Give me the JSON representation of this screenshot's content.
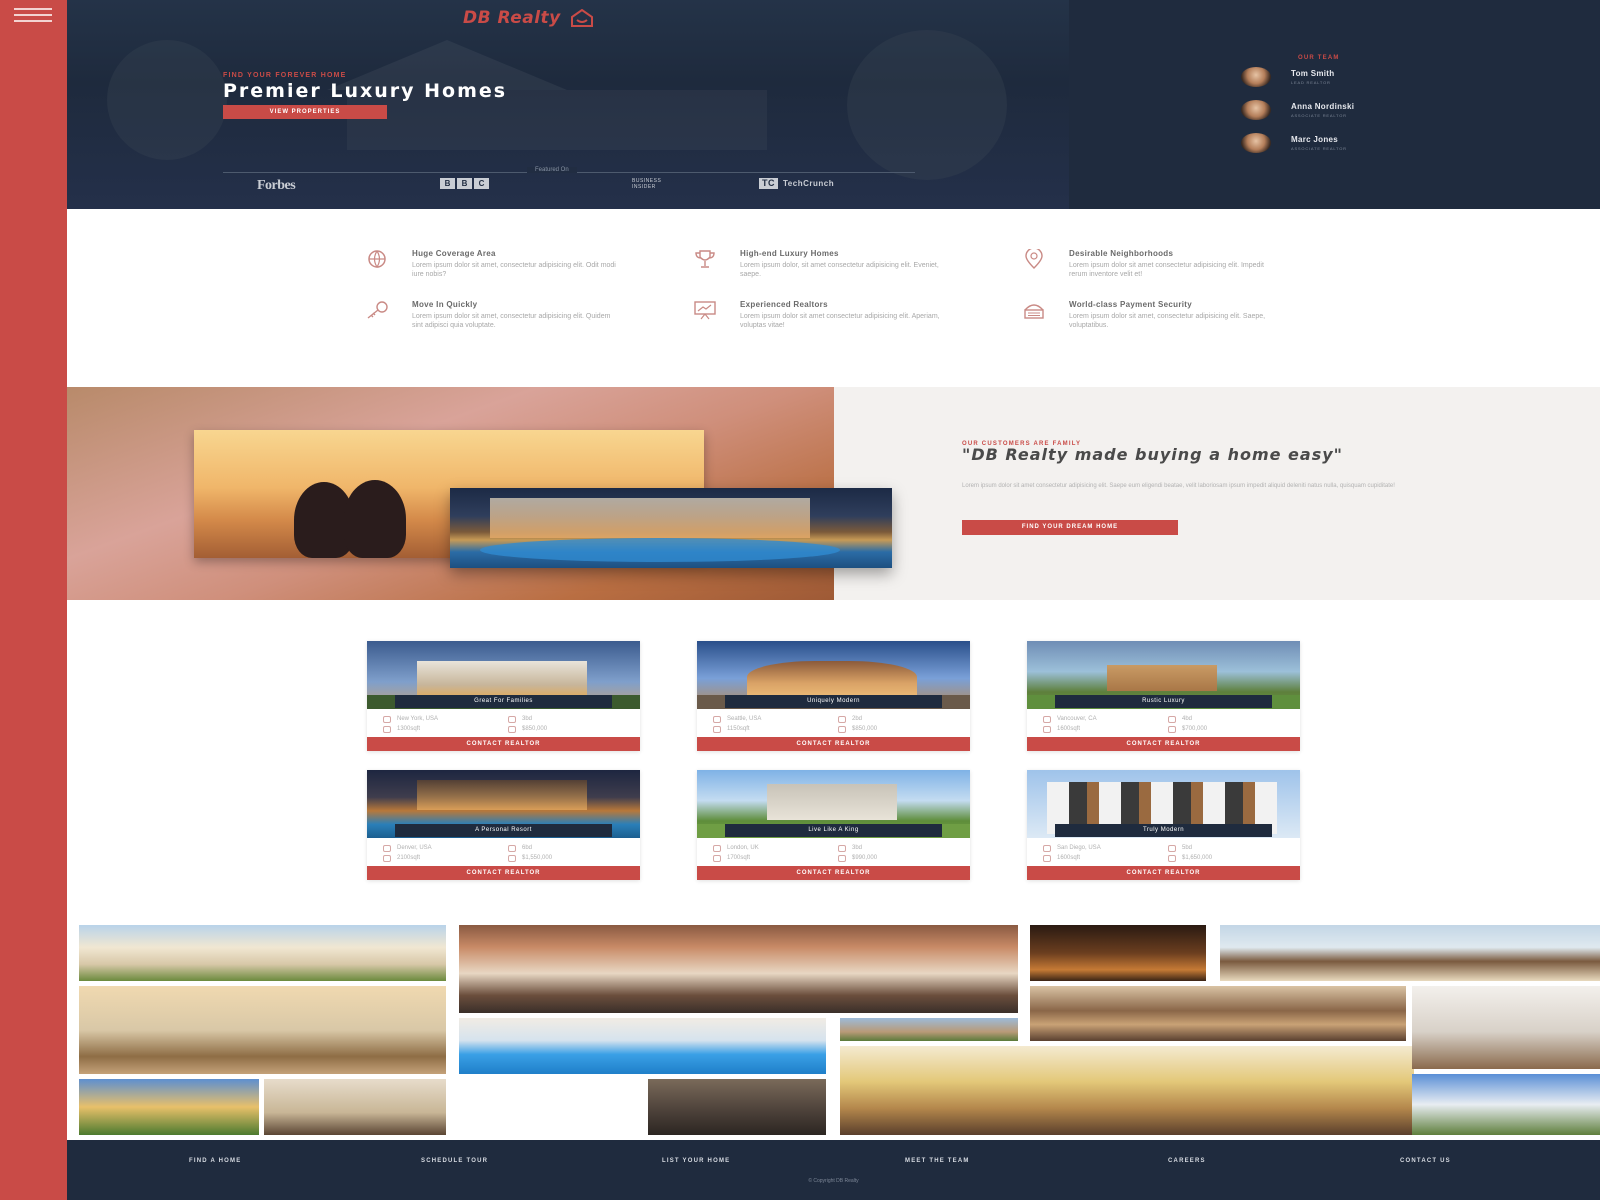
{
  "brand": {
    "name": "DB Realty",
    "accent": "#c94b47",
    "navy": "#1f2b3e"
  },
  "hero": {
    "eyebrow": "FIND YOUR FOREVER HOME",
    "title": "Premier Luxury Homes",
    "button": "VIEW PROPERTIES",
    "featured_label": "Featured On",
    "press": {
      "forbes": "Forbes",
      "bbc": [
        "B",
        "B",
        "C"
      ],
      "business_insider": [
        "BUSINESS",
        "INSIDER"
      ],
      "techcrunch_mark": "TC",
      "techcrunch": "TechCrunch"
    }
  },
  "team": {
    "label": "OUR TEAM",
    "members": [
      {
        "name": "Tom Smith",
        "role": "LEAD REALTOR"
      },
      {
        "name": "Anna Nordinski",
        "role": "ASSOCIATE REALTOR"
      },
      {
        "name": "Marc Jones",
        "role": "ASSOCIATE REALTOR"
      }
    ]
  },
  "features": [
    {
      "icon": "globe-icon",
      "title": "Huge Coverage Area",
      "desc": "Lorem ipsum dolor sit amet, consectetur adipisicing elit. Odit modi iure nobis?"
    },
    {
      "icon": "trophy-icon",
      "title": "High-end Luxury Homes",
      "desc": "Lorem ipsum dolor, sit amet consectetur adipisicing elit. Eveniet, saepe."
    },
    {
      "icon": "location-pin-icon",
      "title": "Desirable Neighborhoods",
      "desc": "Lorem ipsum dolor sit amet consectetur adipisicing elit. Impedit rerum inventore velit et!"
    },
    {
      "icon": "key-icon",
      "title": "Move In Quickly",
      "desc": "Lorem ipsum dolor sit amet, consectetur adipisicing elit. Quidem sint adipisci quia voluptate."
    },
    {
      "icon": "presentation-icon",
      "title": "Experienced Realtors",
      "desc": "Lorem ipsum dolor sit amet consectetur adipisicing elit. Aperiam, voluptas vitae!"
    },
    {
      "icon": "secure-payment-icon",
      "title": "World-class Payment Security",
      "desc": "Lorem ipsum dolor sit amet, consectetur adipisicing elit. Saepe, voluptatibus."
    }
  ],
  "testimonial": {
    "eyebrow": "OUR CUSTOMERS ARE FAMILY",
    "quote": "\"DB Realty made buying a home easy\"",
    "sub": "Lorem ipsum dolor sit amet consectetur adipisicing elit. Saepe eum eligendi beatae, velit laboriosam ipsum impedit aliquid deleniti natus nulla, quisquam cupiditate!",
    "button": "FIND YOUR DREAM HOME"
  },
  "listings": [
    {
      "title": "Great For Families",
      "location": "New York, USA",
      "beds": "3bd",
      "sqft": "1300sqft",
      "price": "$850,000",
      "cta": "CONTACT REALTOR"
    },
    {
      "title": "Uniquely Modern",
      "location": "Seattle, USA",
      "beds": "2bd",
      "sqft": "1150sqft",
      "price": "$850,000",
      "cta": "CONTACT REALTOR"
    },
    {
      "title": "Rustic Luxury",
      "location": "Vancouver, CA",
      "beds": "4bd",
      "sqft": "1600sqft",
      "price": "$700,000",
      "cta": "CONTACT REALTOR"
    },
    {
      "title": "A Personal Resort",
      "location": "Denver, USA",
      "beds": "6bd",
      "sqft": "2100sqft",
      "price": "$1,550,000",
      "cta": "CONTACT REALTOR"
    },
    {
      "title": "Live Like A King",
      "location": "London, UK",
      "beds": "3bd",
      "sqft": "1700sqft",
      "price": "$990,000",
      "cta": "CONTACT REALTOR"
    },
    {
      "title": "Truly Modern",
      "location": "San Diego, USA",
      "beds": "5bd",
      "sqft": "1600sqft",
      "price": "$1,650,000",
      "cta": "CONTACT REALTOR"
    }
  ],
  "footer": {
    "links": [
      "FIND A HOME",
      "SCHEDULE TOUR",
      "LIST YOUR HOME",
      "MEET THE TEAM",
      "CAREERS",
      "CONTACT US"
    ],
    "copyright": "© Copyright DB Realty"
  }
}
